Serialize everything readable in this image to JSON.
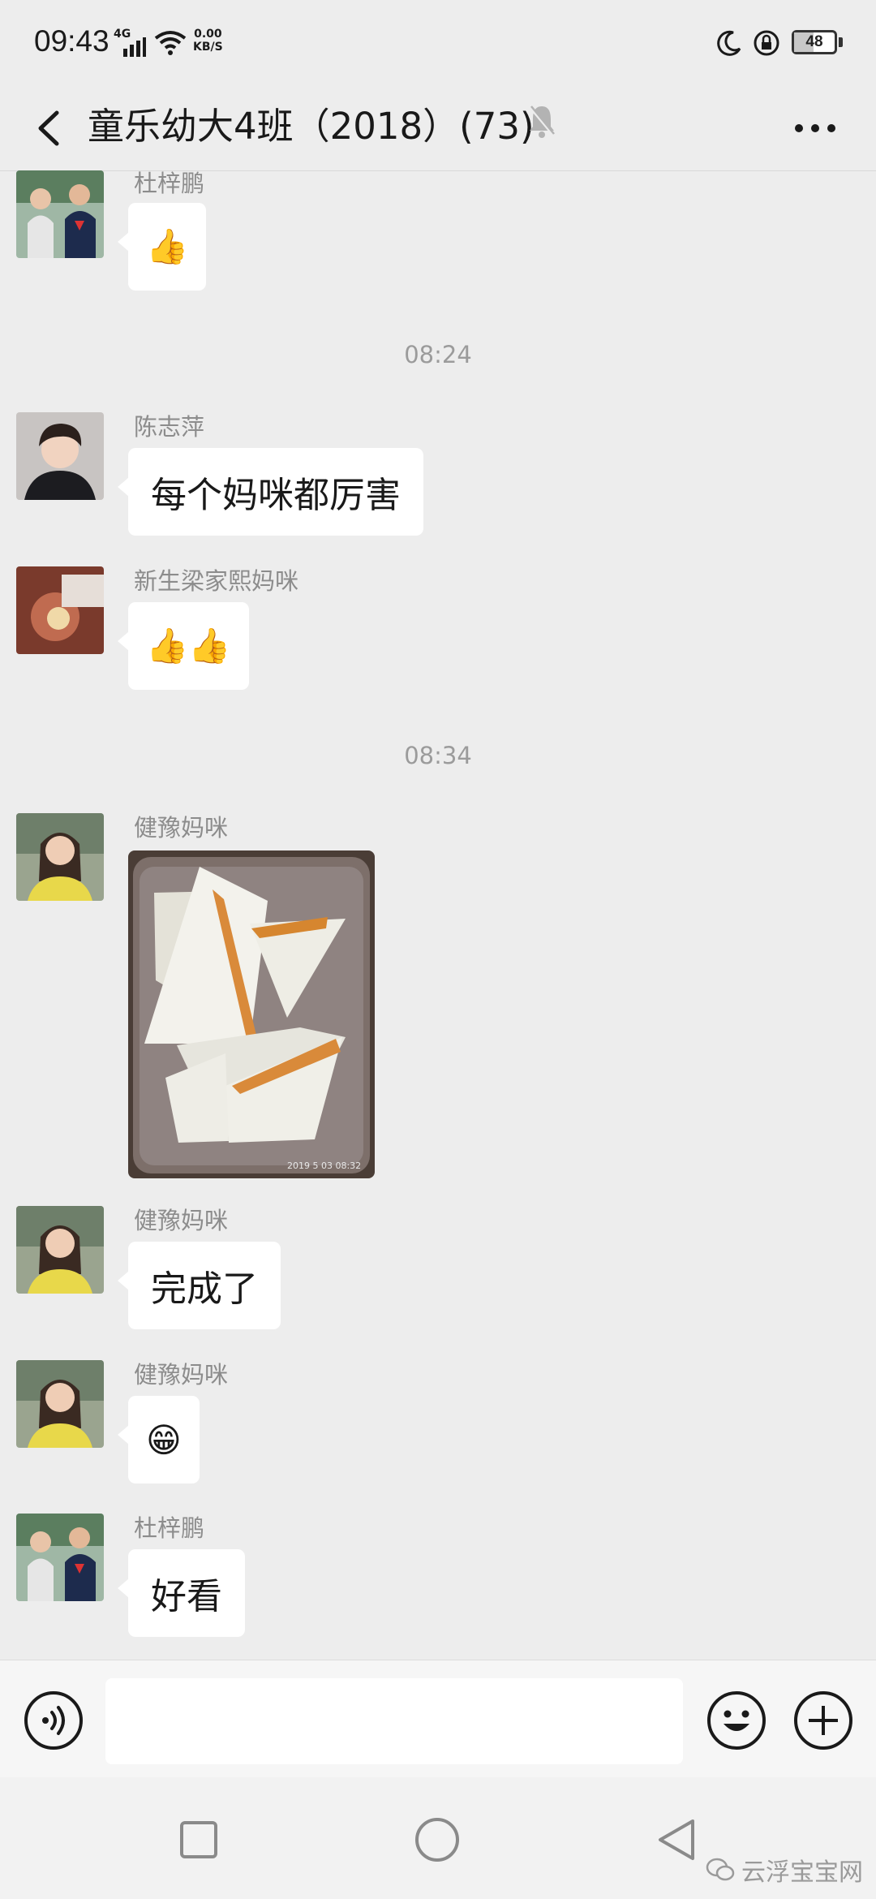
{
  "status_bar": {
    "time": "09:43",
    "network": "4G",
    "speed_value": "0.00",
    "speed_unit": "KB/S",
    "battery": "48",
    "battery_level": 0.48
  },
  "header": {
    "title": "童乐幼大4班（2018）(73)",
    "back_icon": "chevron-left-icon",
    "mute_icon": "bell-off-icon",
    "more_icon": "more-dots-icon"
  },
  "messages": [
    {
      "sender": "杜梓鹏",
      "type": "emoji",
      "content": "👍"
    },
    {
      "type": "timestamp",
      "content": "08:24"
    },
    {
      "sender": "陈志萍",
      "type": "text",
      "content": "每个妈咪都厉害"
    },
    {
      "sender": "新生梁家熙妈咪",
      "type": "emoji",
      "content": "👍👍"
    },
    {
      "type": "timestamp",
      "content": "08:34"
    },
    {
      "sender": "健豫妈咪",
      "type": "image",
      "caption": "2019 5 03 08:32"
    },
    {
      "sender": "健豫妈咪",
      "type": "text",
      "content": "完成了"
    },
    {
      "sender": "健豫妈咪",
      "type": "emoji",
      "content": "😁"
    },
    {
      "sender": "杜梓鹏",
      "type": "text",
      "content": "好看"
    }
  ],
  "input_bar": {
    "placeholder": "",
    "voice_icon": "voice-icon",
    "emoji_icon": "smiley-icon",
    "plus_icon": "plus-icon"
  },
  "nav_bar": {
    "buttons": [
      "recents-icon",
      "home-icon",
      "back-triangle-icon"
    ],
    "watermark": "云浮宝宝网"
  }
}
